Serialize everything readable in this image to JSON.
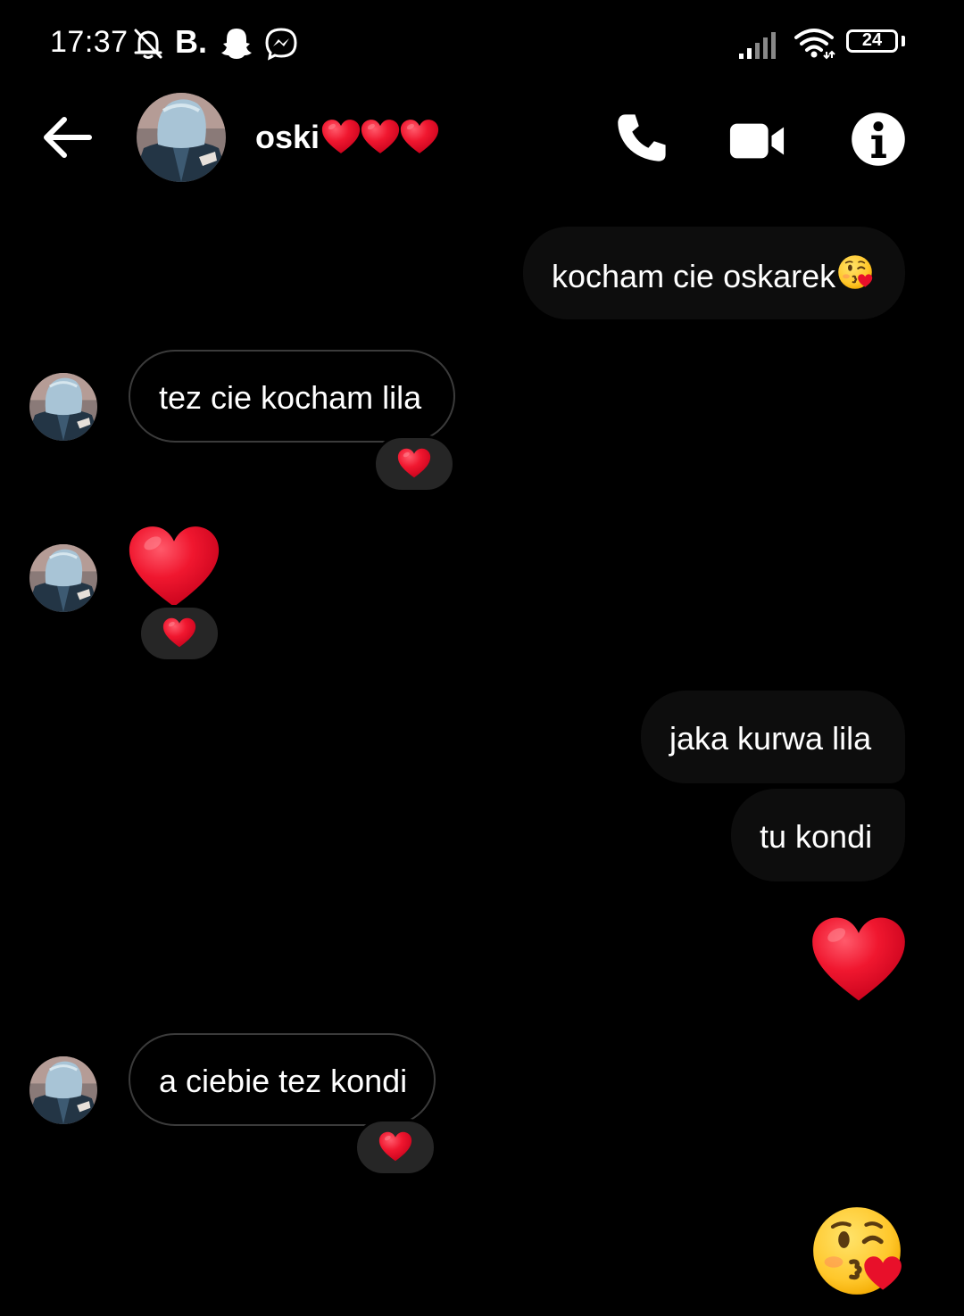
{
  "status_bar": {
    "time": "17:37",
    "letter_icon": "B.",
    "battery": "24",
    "icons": [
      "bell-off-icon",
      "snapchat-ghost-icon",
      "messenger-icon",
      "signal-bars-icon",
      "wifi-icon",
      "battery-icon"
    ]
  },
  "header": {
    "contact_name": "oski",
    "name_suffix": "❤️❤️❤️",
    "icons": [
      "back-arrow-icon",
      "phone-icon",
      "video-camera-icon",
      "info-icon"
    ]
  },
  "messages": [
    {
      "id": "m1",
      "sender": "me",
      "type": "text",
      "text": "kocham cie oskarek",
      "trailing_emoji": "😘"
    },
    {
      "id": "m2",
      "sender": "contact",
      "type": "text",
      "text": "tez cie kocham lila",
      "reaction": "❤️"
    },
    {
      "id": "m3",
      "sender": "contact",
      "type": "emoji",
      "emoji": "❤️",
      "reaction": "❤️"
    },
    {
      "id": "m4",
      "sender": "me",
      "type": "text",
      "text": "jaka kurwa lila"
    },
    {
      "id": "m5",
      "sender": "me",
      "type": "text",
      "text": "tu kondi"
    },
    {
      "id": "m6",
      "sender": "me",
      "type": "emoji",
      "emoji": "❤️"
    },
    {
      "id": "m7",
      "sender": "contact",
      "type": "text",
      "text": "a ciebie tez kondi",
      "reaction": "❤️"
    },
    {
      "id": "m8",
      "sender": "me",
      "type": "emoji",
      "emoji": "😘"
    }
  ],
  "colors": {
    "background": "#000000",
    "outgoing_bubble": "#0d0d0d",
    "incoming_border": "#3b3b3b",
    "reaction_pill": "#262626",
    "heart": "#e8102a"
  }
}
